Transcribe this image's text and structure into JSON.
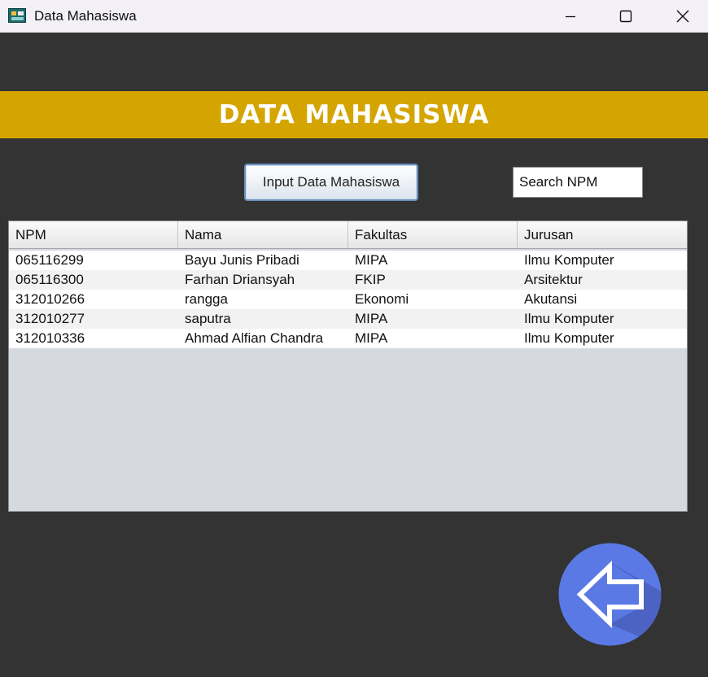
{
  "window": {
    "title": "Data Mahasiswa",
    "controls": [
      "minimize-icon",
      "maximize-icon",
      "close-icon"
    ]
  },
  "header": {
    "title": "DATA MAHASISWA"
  },
  "toolbar": {
    "input_button_label": "Input Data Mahasiswa",
    "search_value": "Search NPM"
  },
  "table": {
    "columns": [
      "NPM",
      "Nama",
      "Fakultas",
      "Jurusan"
    ],
    "rows": [
      [
        "065116299",
        "Bayu Junis Pribadi",
        "MIPA",
        "Ilmu Komputer"
      ],
      [
        "065116300",
        "Farhan Driansyah",
        "FKIP",
        "Arsitektur"
      ],
      [
        "312010266",
        "rangga",
        "Ekonomi",
        "Akutansi"
      ],
      [
        "312010277",
        "saputra",
        "MIPA",
        "Ilmu Komputer"
      ],
      [
        "312010336",
        "Ahmad Alfian Chandra",
        "MIPA",
        "Ilmu Komputer"
      ]
    ]
  },
  "back": {
    "icon": "arrow-left-icon"
  },
  "colors": {
    "background": "#333333",
    "banner": "#d4a500",
    "back_button": "#5b79e4"
  }
}
